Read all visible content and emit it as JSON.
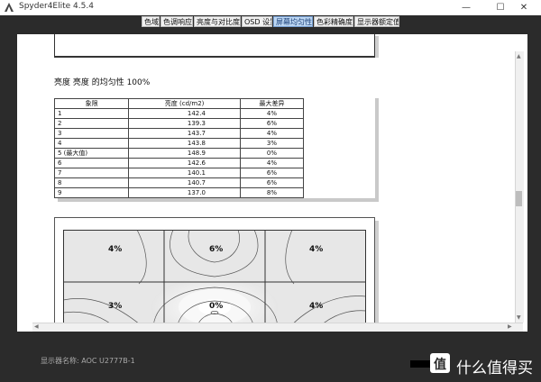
{
  "window": {
    "title": "Spyder4Elite 4.5.4",
    "controls": {
      "minimize": "—",
      "maximize": "☐",
      "close": "✕"
    }
  },
  "tabs": [
    {
      "label": "色域",
      "active": false
    },
    {
      "label": "色调响应",
      "active": false
    },
    {
      "label": "亮度与对比度",
      "active": false
    },
    {
      "label": "OSD 设置",
      "active": false
    },
    {
      "label": "屏幕均匀性",
      "active": true
    },
    {
      "label": "色彩精确度",
      "active": false
    },
    {
      "label": "显示器额定值",
      "active": false
    }
  ],
  "zoom": {
    "icons": [
      "zoom-in-icon",
      "zoom-out-icon",
      "zoom-fit-icon"
    ]
  },
  "report": {
    "uniformity_title": "亮度 亮度 的均匀性 100%",
    "table": {
      "headers": [
        "象限",
        "亮度 (cd/m2)",
        "最大差异"
      ],
      "rows": [
        [
          "1",
          "142.4",
          "4%"
        ],
        [
          "2",
          "139.3",
          "6%"
        ],
        [
          "3",
          "143.7",
          "4%"
        ],
        [
          "4",
          "143.8",
          "3%"
        ],
        [
          "5 (最大值)",
          "148.9",
          "0%"
        ],
        [
          "6",
          "142.6",
          "4%"
        ],
        [
          "7",
          "140.1",
          "6%"
        ],
        [
          "8",
          "140.7",
          "6%"
        ],
        [
          "9",
          "137.0",
          "8%"
        ]
      ]
    },
    "map_labels": {
      "q1": "4%",
      "q2": "6%",
      "q3": "4%",
      "q4": "3%",
      "q5": "0%",
      "q6": "4%"
    }
  },
  "status": {
    "monitor_label": "显示器名称: AOC U2777B-1"
  },
  "watermark": {
    "logo_char": "值",
    "text": "什么值得买"
  },
  "colors": {
    "window_bg": "#2b2b2b",
    "active_tab": "#bcd6f2",
    "page_bg": "#ffffff"
  }
}
